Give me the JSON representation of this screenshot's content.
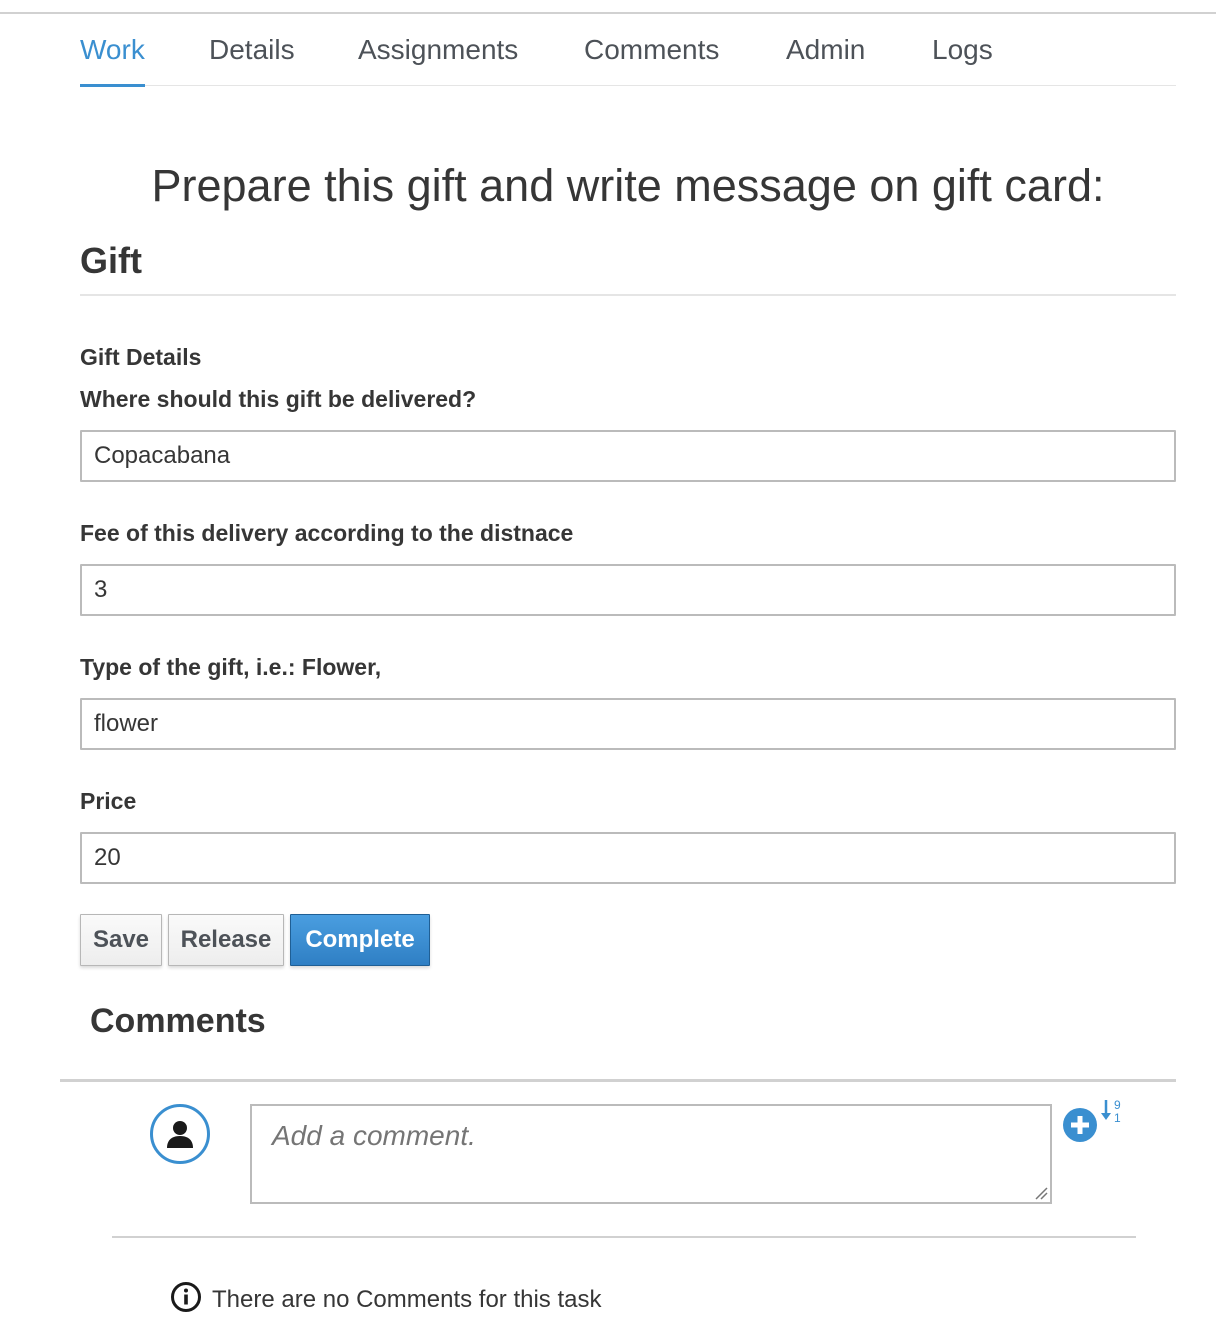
{
  "tabs": [
    {
      "label": "Work",
      "active": true
    },
    {
      "label": "Details",
      "active": false
    },
    {
      "label": "Assignments",
      "active": false
    },
    {
      "label": "Comments",
      "active": false
    },
    {
      "label": "Admin",
      "active": false
    },
    {
      "label": "Logs",
      "active": false
    }
  ],
  "task": {
    "title": "Prepare this gift and write message on gift card:",
    "section_title": "Gift",
    "group_label": "Gift Details"
  },
  "form": {
    "fields": [
      {
        "label": "Where should this gift be delivered?",
        "value": "Copacabana"
      },
      {
        "label": "Fee of this delivery according to the distnace",
        "value": "3"
      },
      {
        "label": "Type of the gift, i.e.: Flower,",
        "value": "flower"
      },
      {
        "label": "Price",
        "value": "20"
      }
    ]
  },
  "actions": {
    "save": "Save",
    "release": "Release",
    "complete": "Complete"
  },
  "comments": {
    "heading": "Comments",
    "placeholder": "Add a comment.",
    "empty_message": "There are no Comments for this task",
    "sort_digits_top": "9",
    "sort_digits_bottom": "1"
  },
  "colors": {
    "accent": "#3a8fd0",
    "primary_button": "#3a8fd0",
    "text": "#363636"
  },
  "icons": [
    "user-avatar-icon",
    "add-comment-icon",
    "sort-numeric-icon",
    "info-icon",
    "resize-grip-icon"
  ]
}
